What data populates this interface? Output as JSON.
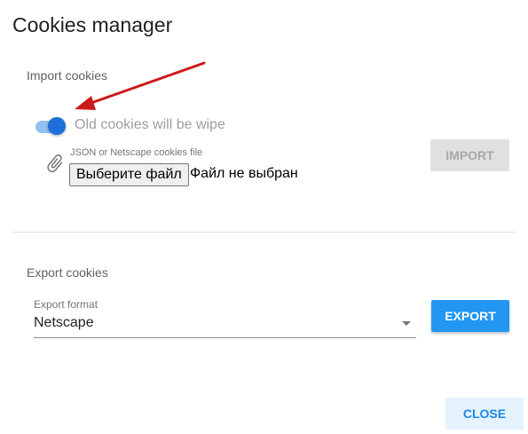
{
  "dialog": {
    "title": "Cookies manager"
  },
  "import": {
    "title": "Import cookies",
    "toggle_label": "Old cookies will be wipe",
    "toggle_on": true,
    "file_caption": "JSON or Netscape cookies file",
    "file_button": "Выберите файл",
    "file_status": "Файл не выбран",
    "import_button": "IMPORT"
  },
  "export": {
    "title": "Export cookies",
    "format_caption": "Export format",
    "format_value": "Netscape",
    "export_button": "EXPORT"
  },
  "footer": {
    "close_button": "CLOSE"
  },
  "colors": {
    "accent": "#2196f3",
    "toggle": "#1e6fd9",
    "arrow": "#cc1a1a"
  }
}
